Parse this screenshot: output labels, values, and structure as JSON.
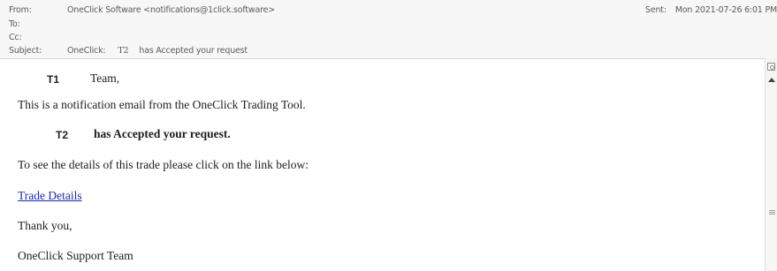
{
  "header": {
    "from_label": "From:",
    "from_value": "OneClick Software <notifications@1click.software>",
    "to_label": "To:",
    "cc_label": "Cc:",
    "subject_label": "Subject:",
    "subject_prefix": "OneClick:",
    "subject_t2": "T2",
    "subject_rest": "has Accepted your request",
    "sent_label": "Sent:",
    "sent_value": "Mon 2021-07-26 6:01 PM"
  },
  "message": {
    "greeting_t": "T1",
    "greeting_team": "Team,",
    "notification": "This is a notification email from the OneClick Trading Tool.",
    "accepted_t": "T2",
    "accepted_text": "has Accepted your request.",
    "see_details": "To see the details of this trade please click on the link below:",
    "link_text": "Trade Details",
    "thanks": "Thank you,",
    "signoff": "OneClick Support Team"
  },
  "icons": {
    "scroll_top_icon": "image-icon",
    "scroll_up_icon": "arrow-up-icon",
    "scroll_grip_icon": "grip-icon"
  }
}
